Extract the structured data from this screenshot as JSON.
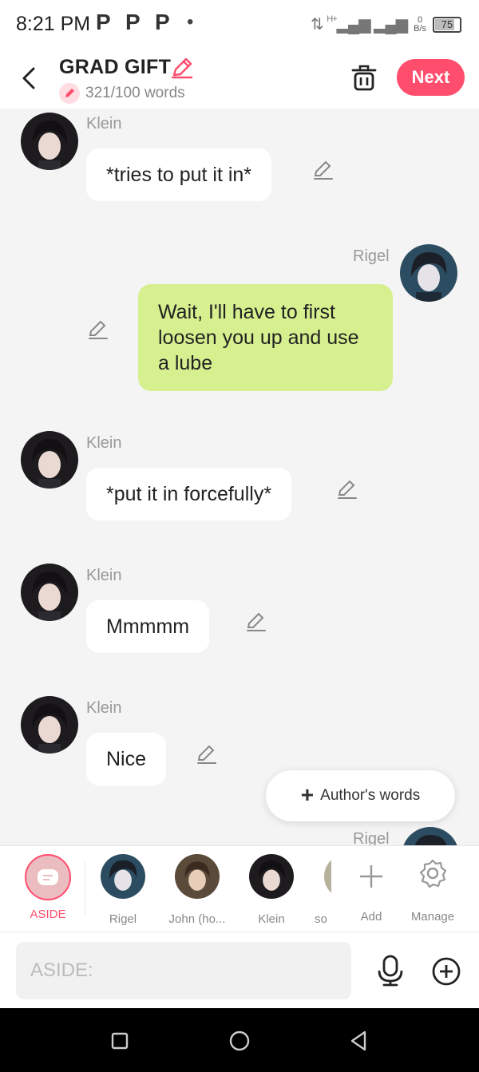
{
  "status_bar": {
    "time": "8:21 PM",
    "indicators": [
      "P",
      "P",
      "P"
    ],
    "network": "H+",
    "speed_value": "0",
    "speed_unit": "B/s",
    "battery": "75"
  },
  "header": {
    "title": "GRAD GIFT",
    "word_count": "321/100 words",
    "next_label": "Next"
  },
  "messages": [
    {
      "sender": "Klein",
      "text": "*tries to put it in*",
      "side": "left"
    },
    {
      "sender": "Rigel",
      "text": "Wait, I'll have to first loosen you up and use a lube",
      "side": "right"
    },
    {
      "sender": "Klein",
      "text": "*put it in forcefully*",
      "side": "left"
    },
    {
      "sender": "Klein",
      "text": "Mmmmm",
      "side": "left"
    },
    {
      "sender": "Klein",
      "text": "Nice",
      "side": "left"
    },
    {
      "sender": "Rigel",
      "text": "",
      "side": "right"
    }
  ],
  "author_words_label": "Author's words",
  "characters": [
    {
      "label": "ASIDE",
      "active": true
    },
    {
      "label": "Rigel"
    },
    {
      "label": "John (ho..."
    },
    {
      "label": "Klein"
    },
    {
      "label": "so i"
    }
  ],
  "char_actions": {
    "add_label": "Add",
    "manage_label": "Manage"
  },
  "input": {
    "placeholder": "ASIDE:"
  },
  "colors": {
    "accent": "#ff4d6d",
    "my_bubble": "#d6f08f",
    "bubble": "#ffffff",
    "background": "#f4f4f4"
  },
  "icons": [
    "back-icon",
    "pencil-icon",
    "trash-icon",
    "edit-icon",
    "plus-icon",
    "gear-icon",
    "microphone-icon",
    "add-circle-icon",
    "square-icon",
    "circle-icon",
    "triangle-back-icon"
  ]
}
